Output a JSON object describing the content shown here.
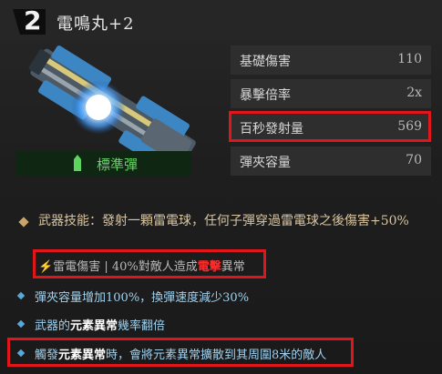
{
  "header": {
    "slot_number": "2",
    "weapon_name": "電鳴丸+2"
  },
  "ammo": {
    "label": "標準彈",
    "icon": "bullet-icon"
  },
  "stats": [
    {
      "label": "基礎傷害",
      "value": "110"
    },
    {
      "label": "暴擊倍率",
      "value": "2x"
    },
    {
      "label": "百秒發射量",
      "value": "569"
    },
    {
      "label": "彈夾容量",
      "value": "70"
    }
  ],
  "skill": {
    "text": "武器技能：發射一顆雷電球，任何子彈穿過雷電球之後傷害+50%"
  },
  "damage_line": {
    "icon": "lightning-icon",
    "type": "雷電傷害",
    "separator": "|",
    "pre": "40%對敵人造成",
    "highlight": "電擊",
    "post": "異常"
  },
  "perks": [
    {
      "parts": [
        "彈夾容量增加100%，換彈速度減少30%"
      ]
    },
    {
      "pre": "武器的",
      "bold": "元素異常",
      "post": "幾率翻倍"
    },
    {
      "pre": "觸發",
      "bold": "元素異常",
      "post": "時，會將元素異常擴散到其周圍8米的敵人"
    }
  ],
  "colors": {
    "highlight_border": "#e0161b",
    "ammo_green": "#6cd36c",
    "perk_blue": "#9fd1ef",
    "lightning": "#2f8dff"
  }
}
